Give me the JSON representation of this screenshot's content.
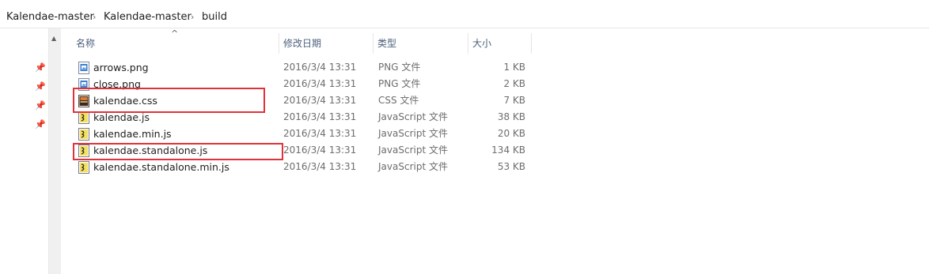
{
  "breadcrumb": {
    "items": [
      "Kalendae-master",
      "Kalendae-master",
      "build"
    ],
    "separator": "›"
  },
  "columns": {
    "name": "名称",
    "modified": "修改日期",
    "type": "类型",
    "size": "大小"
  },
  "files": [
    {
      "name": "arrows.png",
      "modified": "2016/3/4 13:31",
      "type": "PNG 文件",
      "size": "1 KB",
      "icon": "png-file-icon"
    },
    {
      "name": "close.png",
      "modified": "2016/3/4 13:31",
      "type": "PNG 文件",
      "size": "2 KB",
      "icon": "png-file-icon"
    },
    {
      "name": "kalendae.css",
      "modified": "2016/3/4 13:31",
      "type": "CSS 文件",
      "size": "7 KB",
      "icon": "css-file-icon"
    },
    {
      "name": "kalendae.js",
      "modified": "2016/3/4 13:31",
      "type": "JavaScript 文件",
      "size": "38 KB",
      "icon": "js-file-icon"
    },
    {
      "name": "kalendae.min.js",
      "modified": "2016/3/4 13:31",
      "type": "JavaScript 文件",
      "size": "20 KB",
      "icon": "js-file-icon"
    },
    {
      "name": "kalendae.standalone.js",
      "modified": "2016/3/4 13:31",
      "type": "JavaScript 文件",
      "size": "134 KB",
      "icon": "js-file-icon"
    },
    {
      "name": "kalendae.standalone.min.js",
      "modified": "2016/3/4 13:31",
      "type": "JavaScript 文件",
      "size": "53 KB",
      "icon": "js-file-icon"
    }
  ],
  "highlighted_files": [
    "kalendae.css",
    "kalendae.standalone.js"
  ],
  "colors": {
    "highlight": "#e0323a",
    "header_text": "#4c607a"
  }
}
